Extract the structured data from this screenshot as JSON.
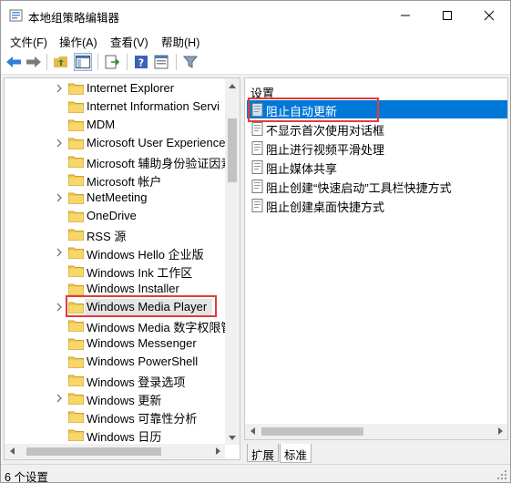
{
  "window": {
    "title": "本地组策略编辑器"
  },
  "menu": [
    {
      "label": "文件(F)"
    },
    {
      "label": "操作(A)"
    },
    {
      "label": "查看(V)"
    },
    {
      "label": "帮助(H)"
    }
  ],
  "toolbar": {
    "icons": [
      "back-arrow-icon",
      "forward-arrow-icon",
      "up-folder-icon",
      "show-tree-icon",
      "export-list-icon",
      "help-icon",
      "properties-icon",
      "filter-icon"
    ]
  },
  "tree": {
    "items": [
      {
        "label": "Internet Explorer",
        "expandable": true
      },
      {
        "label": "Internet Information Servi",
        "expandable": false
      },
      {
        "label": "MDM",
        "expandable": false
      },
      {
        "label": "Microsoft User Experience",
        "expandable": true
      },
      {
        "label": "Microsoft 辅助身份验证因素",
        "expandable": false
      },
      {
        "label": "Microsoft 帐户",
        "expandable": false
      },
      {
        "label": "NetMeeting",
        "expandable": true
      },
      {
        "label": "OneDrive",
        "expandable": false
      },
      {
        "label": "RSS 源",
        "expandable": false
      },
      {
        "label": "Windows Hello 企业版",
        "expandable": true
      },
      {
        "label": "Windows Ink 工作区",
        "expandable": false
      },
      {
        "label": "Windows Installer",
        "expandable": false
      },
      {
        "label": "Windows Media Player",
        "expandable": true,
        "selected": true
      },
      {
        "label": "Windows Media 数字权限管",
        "expandable": false
      },
      {
        "label": "Windows Messenger",
        "expandable": false
      },
      {
        "label": "Windows PowerShell",
        "expandable": false
      },
      {
        "label": "Windows 登录选项",
        "expandable": false
      },
      {
        "label": "Windows 更新",
        "expandable": true
      },
      {
        "label": "Windows 可靠性分析",
        "expandable": false
      },
      {
        "label": "Windows 日历",
        "expandable": false
      }
    ]
  },
  "settings_pane": {
    "header": "设置",
    "policies": [
      {
        "label": "阻止自动更新",
        "selected": true
      },
      {
        "label": "不显示首次使用对话框"
      },
      {
        "label": "阻止进行视频平滑处理"
      },
      {
        "label": "阻止媒体共享"
      },
      {
        "label": "阻止创建“快速启动”工具栏快捷方式"
      },
      {
        "label": "阻止创建桌面快捷方式"
      }
    ]
  },
  "tabs": [
    {
      "label": "扩展"
    },
    {
      "label": "标准",
      "active": true
    }
  ],
  "status": {
    "text": "6 个设置"
  },
  "colors": {
    "selection": "#0078d7",
    "highlight_box": "#e23b3b",
    "folder": "#f2c94c"
  }
}
